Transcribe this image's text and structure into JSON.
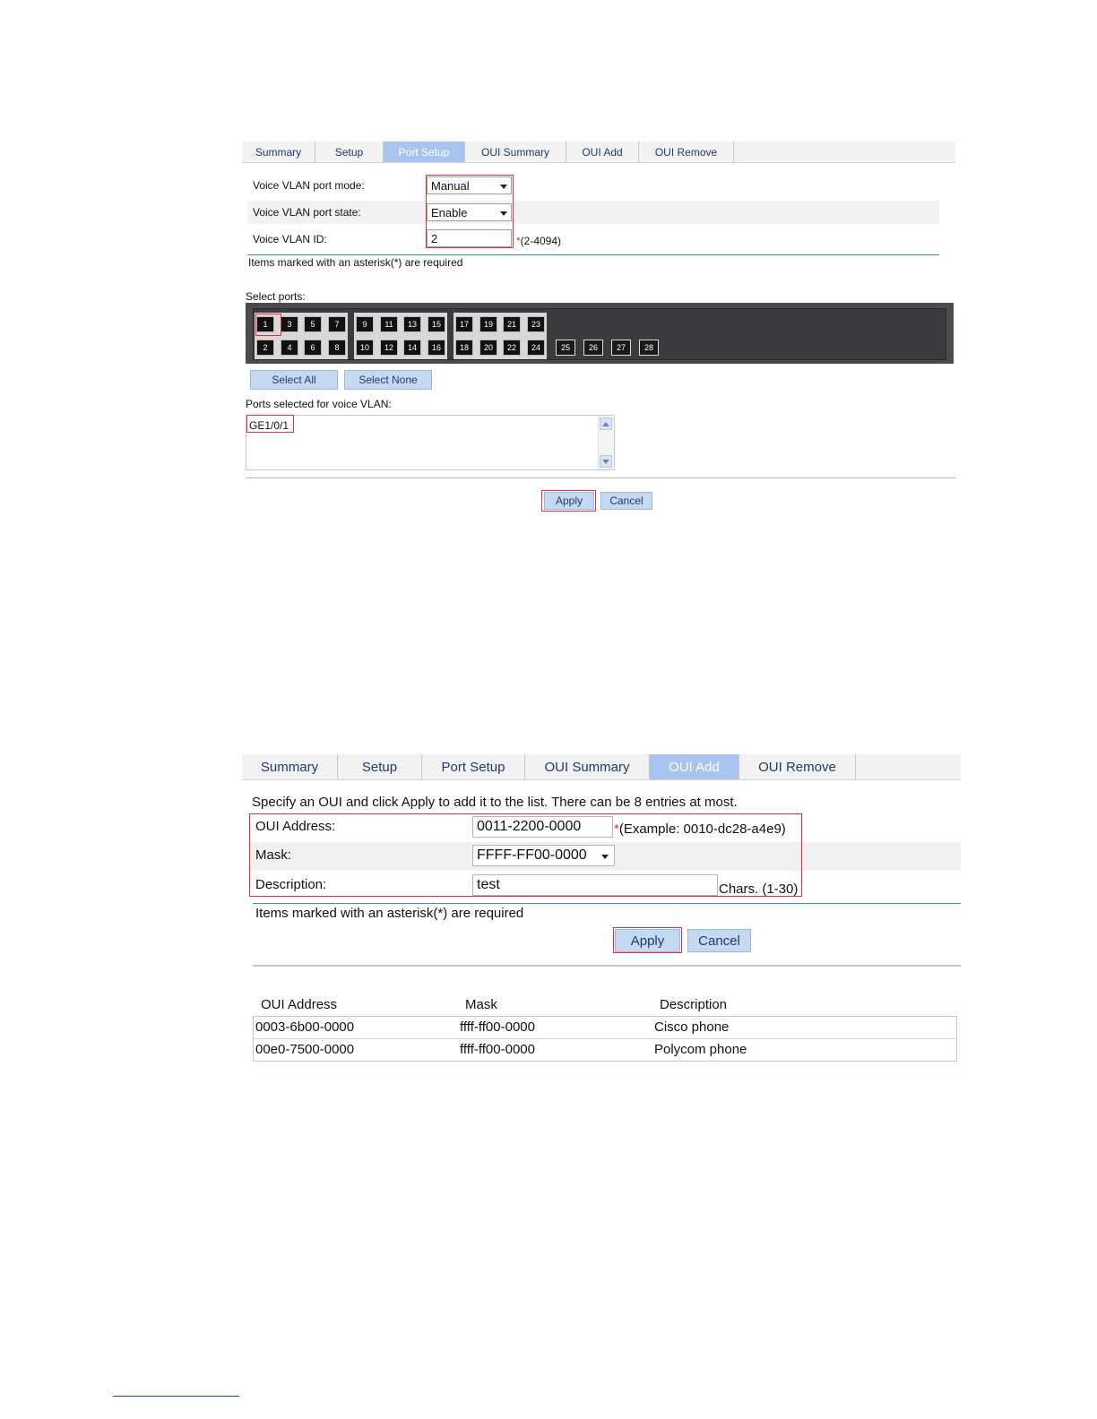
{
  "panel1": {
    "tabs": [
      "Summary",
      "Setup",
      "Port Setup",
      "OUI Summary",
      "OUI Add",
      "OUI Remove"
    ],
    "active_tab": "Port Setup",
    "form": {
      "port_mode_label": "Voice VLAN port mode:",
      "port_mode_value": "Manual",
      "port_state_label": "Voice VLAN port state:",
      "port_state_value": "Enable",
      "vlan_id_label": "Voice VLAN ID:",
      "vlan_id_value": "2",
      "asterisk": "*",
      "vlan_id_hint": "(2-4094)"
    },
    "required_note": "Items marked with an asterisk(*) are required",
    "select_ports_label": "Select ports:",
    "ports_odd": [
      "1",
      "3",
      "5",
      "7",
      "9",
      "11",
      "13",
      "15",
      "17",
      "19",
      "21",
      "23"
    ],
    "ports_even": [
      "2",
      "4",
      "6",
      "8",
      "10",
      "12",
      "14",
      "16",
      "18",
      "20",
      "22",
      "24"
    ],
    "ports_sfp": [
      "25",
      "26",
      "27",
      "28"
    ],
    "selected_port": "1",
    "select_all_label": "Select All",
    "select_none_label": "Select None",
    "ports_selected_label": "Ports selected for voice VLAN:",
    "ports_selected_value": "GE1/0/1",
    "apply_label": "Apply",
    "cancel_label": "Cancel"
  },
  "panel2": {
    "tabs": [
      "Summary",
      "Setup",
      "Port Setup",
      "OUI Summary",
      "OUI Add",
      "OUI Remove"
    ],
    "active_tab": "OUI Add",
    "intro": "Specify an OUI and click Apply to add it to the list. There can be 8 entries at most.",
    "form": {
      "oui_label": "OUI Address:",
      "oui_value": "0011-2200-0000",
      "asterisk": "*",
      "oui_hint": "(Example: 0010-dc28-a4e9)",
      "mask_label": "Mask:",
      "mask_value": "FFFF-FF00-0000",
      "desc_label": "Description:",
      "desc_value": "test",
      "desc_hint": "Chars. (1-30)"
    },
    "required_note": "Items marked with an asterisk(*) are required",
    "apply_label": "Apply",
    "cancel_label": "Cancel",
    "table": {
      "headers": [
        "OUI Address",
        "Mask",
        "Description"
      ],
      "rows": [
        [
          "0003-6b00-0000",
          "ffff-ff00-0000",
          "Cisco phone"
        ],
        [
          "00e0-7500-0000",
          "ffff-ff00-0000",
          "Polycom phone"
        ]
      ]
    }
  },
  "colors": {
    "active_tab_bg": "#a9c4ee",
    "button_bg": "#c6d9f3",
    "highlight_red": "#e0303a",
    "separator_teal": "#2a9cb8"
  }
}
